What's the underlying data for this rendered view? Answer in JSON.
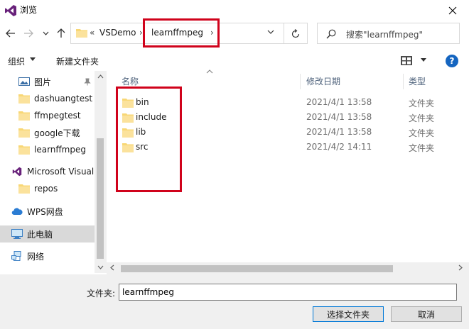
{
  "window": {
    "title": "浏览"
  },
  "address": {
    "crumbs": [
      "VSDemo",
      "learnffmpeg"
    ],
    "overflow": "«"
  },
  "search": {
    "placeholder": "搜索\"learnffmpeg\""
  },
  "toolbar": {
    "organize": "组织",
    "new_folder": "新建文件夹",
    "help": "?"
  },
  "nav": {
    "items": [
      {
        "label": "图片",
        "icon": "pictures-icon"
      },
      {
        "label": "dashuangtest",
        "icon": "folder-icon"
      },
      {
        "label": "ffmpegtest",
        "icon": "folder-icon"
      },
      {
        "label": "google下载",
        "icon": "folder-icon"
      },
      {
        "label": "learnffmpeg",
        "icon": "folder-icon"
      },
      {
        "label": "Microsoft Visual",
        "icon": "visual-studio-icon"
      },
      {
        "label": "repos",
        "icon": "folder-icon"
      },
      {
        "label": "WPS网盘",
        "icon": "cloud-icon"
      },
      {
        "label": "此电脑",
        "icon": "computer-icon"
      },
      {
        "label": "网络",
        "icon": "network-icon"
      }
    ],
    "selected": "此电脑"
  },
  "list": {
    "columns": [
      "名称",
      "修改日期",
      "类型"
    ],
    "rows": [
      {
        "name": "bin",
        "date": "2021/4/1 13:58",
        "type": "文件夹"
      },
      {
        "name": "include",
        "date": "2021/4/1 13:58",
        "type": "文件夹"
      },
      {
        "name": "lib",
        "date": "2021/4/1 13:58",
        "type": "文件夹"
      },
      {
        "name": "src",
        "date": "2021/4/2 14:11",
        "type": "文件夹"
      }
    ]
  },
  "bottom": {
    "filename_label": "文件夹:",
    "filename_value": "learnffmpeg",
    "select_button": "选择文件夹",
    "cancel_button": "取消"
  },
  "colors": {
    "highlight_box": "#d0021b",
    "folder": "#f8d775",
    "accent": "#0078d7"
  }
}
